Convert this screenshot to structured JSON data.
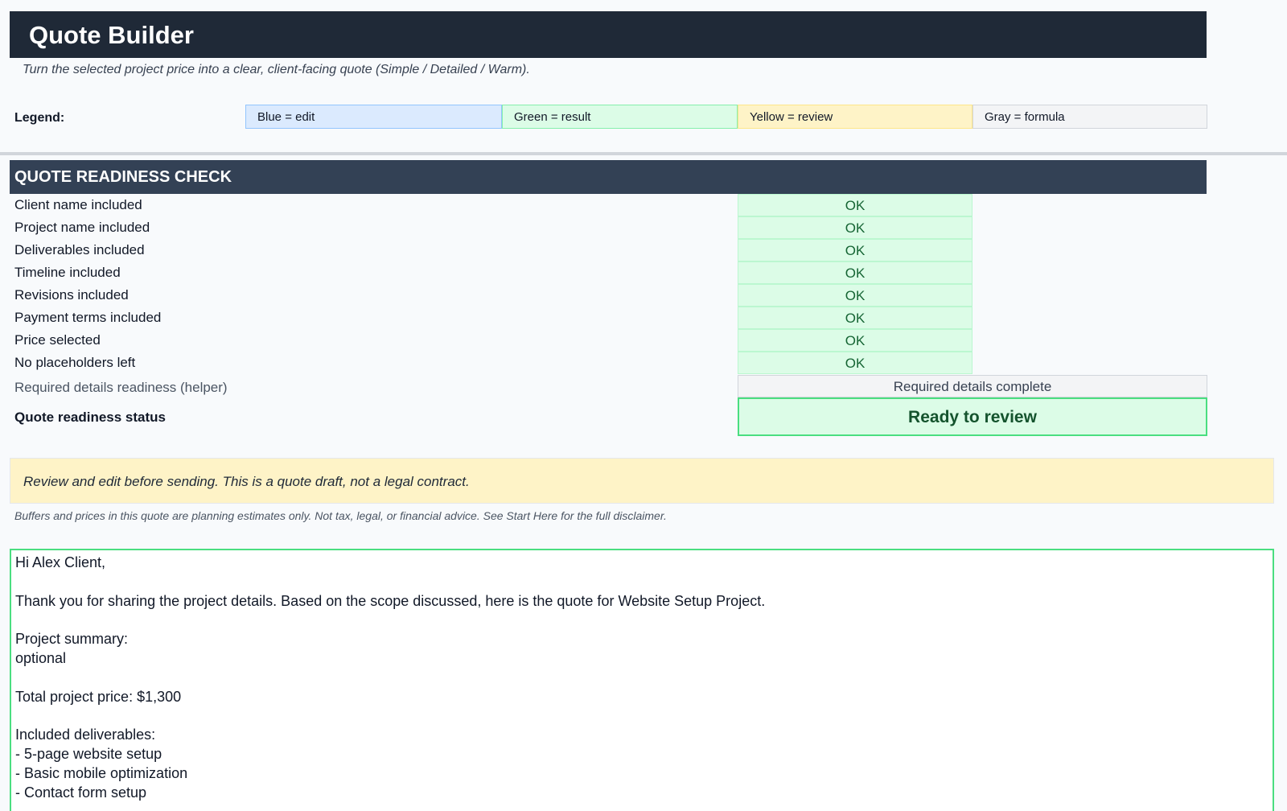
{
  "header": {
    "title": "Quote Builder",
    "subtitle": "Turn the selected project price into a clear, client-facing quote (Simple / Detailed / Warm)."
  },
  "legend": {
    "label": "Legend:",
    "items": [
      {
        "text": "Blue = edit",
        "color": "#dbeafe"
      },
      {
        "text": "Green = result",
        "color": "#dcfce7"
      },
      {
        "text": "Yellow = review",
        "color": "#fef3c7"
      },
      {
        "text": "Gray = formula",
        "color": "#f3f4f6"
      }
    ]
  },
  "readiness": {
    "header": "QUOTE READINESS CHECK",
    "checks": [
      {
        "label": "Client name included",
        "value": "OK"
      },
      {
        "label": "Project name included",
        "value": "OK"
      },
      {
        "label": "Deliverables included",
        "value": "OK"
      },
      {
        "label": "Timeline included",
        "value": "OK"
      },
      {
        "label": "Revisions included",
        "value": "OK"
      },
      {
        "label": "Payment terms included",
        "value": "OK"
      },
      {
        "label": "Price selected",
        "value": "OK"
      },
      {
        "label": "No placeholders left",
        "value": "OK"
      }
    ],
    "helper_label": "Required details readiness (helper)",
    "helper_value": "Required details complete",
    "status_label": "Quote readiness status",
    "status_value": "Ready to review"
  },
  "notice": {
    "banner": "Review and edit before sending. This is a quote draft, not a legal contract.",
    "disclaimer": "Buffers and prices in this quote are planning estimates only. Not tax, legal, or financial advice. See Start Here for the full disclaimer."
  },
  "quote": {
    "lines": [
      "Hi Alex Client,",
      "",
      "Thank you for sharing the project details. Based on the scope discussed, here is the quote for Website Setup Project.",
      "",
      "Project summary:",
      "optional",
      "",
      "Total project price: $1,300",
      "",
      "Included deliverables:",
      "- 5-page website setup",
      "- Basic mobile optimization",
      "- Contact form setup"
    ]
  },
  "colors": {
    "title_bar": "#1f2937",
    "section_header": "#334155",
    "ok_green": "#dcfce7",
    "review_yellow": "#fef3c7"
  }
}
